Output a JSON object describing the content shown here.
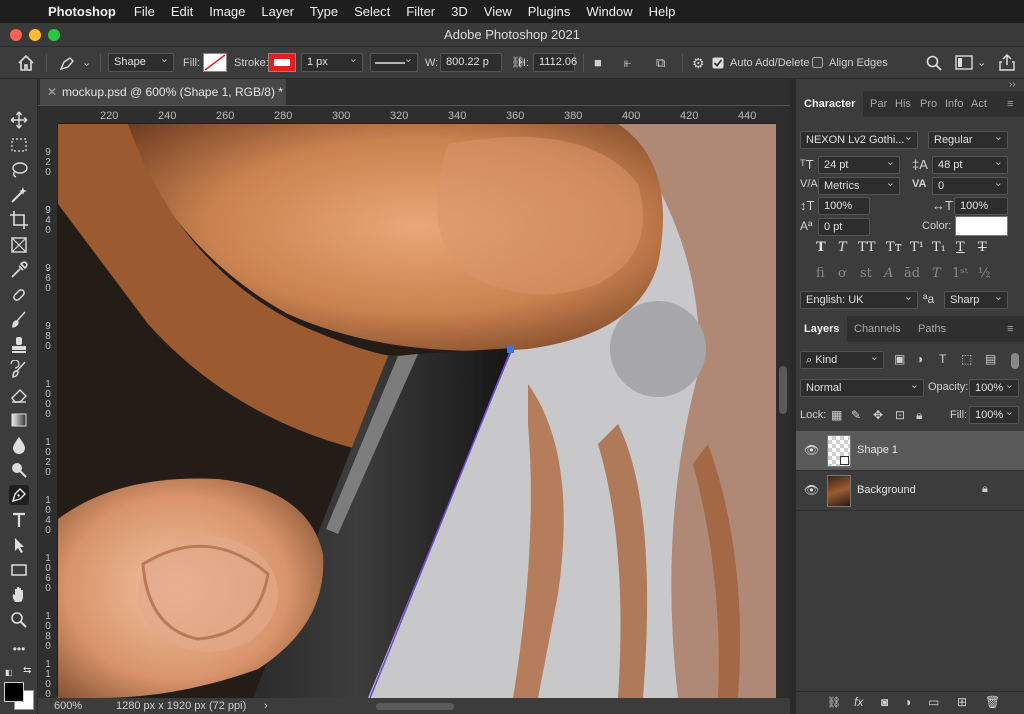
{
  "menubar": {
    "app_name": "Photoshop",
    "items": [
      "File",
      "Edit",
      "Image",
      "Layer",
      "Type",
      "Select",
      "Filter",
      "3D",
      "View",
      "Plugins",
      "Window",
      "Help"
    ]
  },
  "window": {
    "title": "Adobe Photoshop 2021"
  },
  "options_bar": {
    "tool_mode": "Shape",
    "fill_label": "Fill:",
    "stroke_label": "Stroke:",
    "stroke_width": "1 px",
    "w_label": "W:",
    "w_value": "800.22 p",
    "h_label": "H:",
    "h_value": "1112.06",
    "auto_add_delete": "Auto Add/Delete",
    "align_edges": "Align Edges"
  },
  "document_tab": {
    "title": "mockup.psd @ 600% (Shape 1, RGB/8) *"
  },
  "ruler": {
    "h_ticks": [
      "220",
      "240",
      "260",
      "280",
      "300",
      "320",
      "340",
      "360",
      "380",
      "400",
      "420",
      "440"
    ],
    "v_ticks": [
      "9\n2\n0",
      "9\n4\n0",
      "9\n6\n0",
      "9\n8\n0",
      "1\n0\n0\n0",
      "1\n0\n2\n0",
      "1\n0\n4\n0",
      "1\n0\n6\n0",
      "1\n0\n8\n0",
      "1\n1\n0\n0"
    ]
  },
  "status_bar": {
    "zoom": "600%",
    "doc_info": "1280 px x 1920 px (72 ppi)"
  },
  "character_panel": {
    "tabs": [
      "Character",
      "Par",
      "His",
      "Pro",
      "Info",
      "Act"
    ],
    "font_family": "NEXON Lv2 Gothi...",
    "font_style": "Regular",
    "font_size": "24 pt",
    "leading": "48 pt",
    "kerning": "Metrics",
    "tracking": "0",
    "vertical_scale": "100%",
    "horizontal_scale": "100%",
    "baseline_shift": "0 pt",
    "color_label": "Color:",
    "language": "English: UK",
    "antialias": "Sharp"
  },
  "layers_panel": {
    "tabs": [
      "Layers",
      "Channels",
      "Paths"
    ],
    "filter_kind": "Kind",
    "blend_mode": "Normal",
    "opacity_label": "Opacity:",
    "opacity": "100%",
    "lock_label": "Lock:",
    "fill_label": "Fill:",
    "fill": "100%",
    "layers": [
      {
        "name": "Shape 1",
        "selected": true
      },
      {
        "name": "Background",
        "locked": true
      }
    ]
  },
  "colors": {
    "stroke": "#e02020",
    "anchor": "#2a7bff"
  }
}
